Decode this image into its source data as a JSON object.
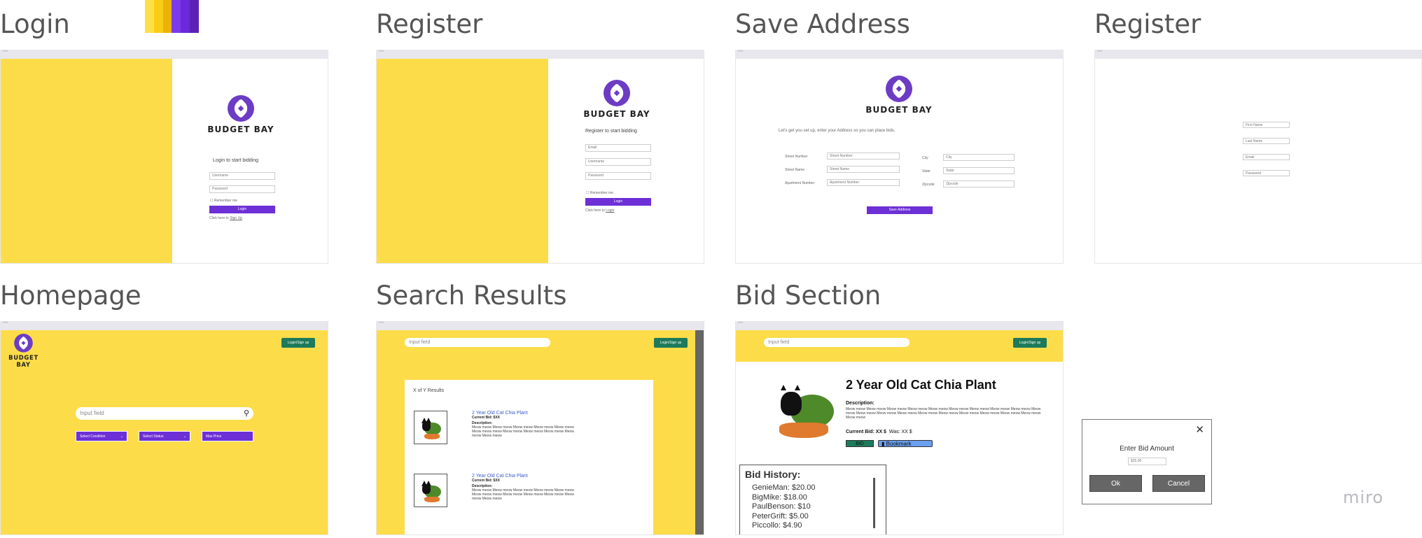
{
  "screens": {
    "login": "Login",
    "register1": "Register",
    "save_address": "Save Address",
    "register2": "Register",
    "homepage": "Homepage",
    "search_results": "Search Results",
    "bid_section": "Bid Section"
  },
  "palette": [
    "#fde047",
    "#facc15",
    "#eab308",
    "#7c3aed",
    "#6d28d9",
    "#5b21b6"
  ],
  "brand": "BUDGET BAY",
  "login": {
    "heading": "Login to start bidding",
    "username": "Username",
    "password": "Password",
    "remember": "Remember me",
    "button": "Login",
    "signup_prefix": "Click here to",
    "signup_link": "Sign Up"
  },
  "register": {
    "heading": "Register to start bidding",
    "email": "Email",
    "username": "Username",
    "password": "Password",
    "remember": "Remember me",
    "button": "Login",
    "login_prefix": "Click here to",
    "login_link": "Login"
  },
  "address": {
    "intro": "Let's get you set up, enter your Address so you can place bids.",
    "street_number_label": "Street Number",
    "street_number_ph": "Street Number",
    "street_name_label": "Street Name",
    "street_name_ph": "Street Name",
    "apt_label": "Apartment Number",
    "apt_ph": "Apartment Number",
    "city_label": "City",
    "city_ph": "City",
    "state_label": "State",
    "state_ph": "State",
    "zip_label": "Zipcode",
    "zip_ph": "Zipcode",
    "button": "Save Address"
  },
  "register2": {
    "first": "First Name",
    "last": "Last Name",
    "email": "Email",
    "password": "Password"
  },
  "homepage": {
    "login_signup": "Login/Sign up",
    "search_ph": "Input field",
    "condition": "Select Condition",
    "status": "Select Status",
    "max_price": "Max Price"
  },
  "search_results": {
    "search_ph": "Input field",
    "login_signup": "Login/Sign up",
    "count": "X of Y Results",
    "items": [
      {
        "title": "2 Year Old Cat Chia Plant",
        "bid": "Current Bid: $XX",
        "desc_label": "Description:"
      },
      {
        "title": "2 Year Old Cat Chia Plant",
        "bid": "Current Bid: $XX",
        "desc_label": "Description:"
      }
    ],
    "lorem": "Meow meow Meow meow Meow meow Meow meow Meow meow Meow meow meow Meow meow Meow meow Meow meow Meow meow Meow meow"
  },
  "bid": {
    "search_ph": "Input field",
    "login_signup": "Login/Sign up",
    "title": "2 Year Old Cat Chia Plant",
    "desc_label": "Description:",
    "desc": "Meow meow Meow meow Meow meow Meow meow Meow meow Meow meow Meow meow Meow meow Meow meow Meow meow Meow meow Meow meow Meow meow Meow meow Meow meow Meow meow Meow meow Meow meow Meow meow Meow meow",
    "current": "Current Bid: XX $",
    "was": "Was: XX $",
    "bid_btn": "BID",
    "bookmark": "Bookmark",
    "history_title": "Bid History:",
    "history": [
      "GenieMan: $20.00",
      "BigMike: $18.00",
      "PaulBenson: $10",
      "PeterGrift: $5.00",
      "Piccollo: $4.90"
    ]
  },
  "modal": {
    "title": "Enter Bid Amount",
    "value": "$25.00",
    "ok": "Ok",
    "cancel": "Cancel"
  },
  "watermark": "miro"
}
